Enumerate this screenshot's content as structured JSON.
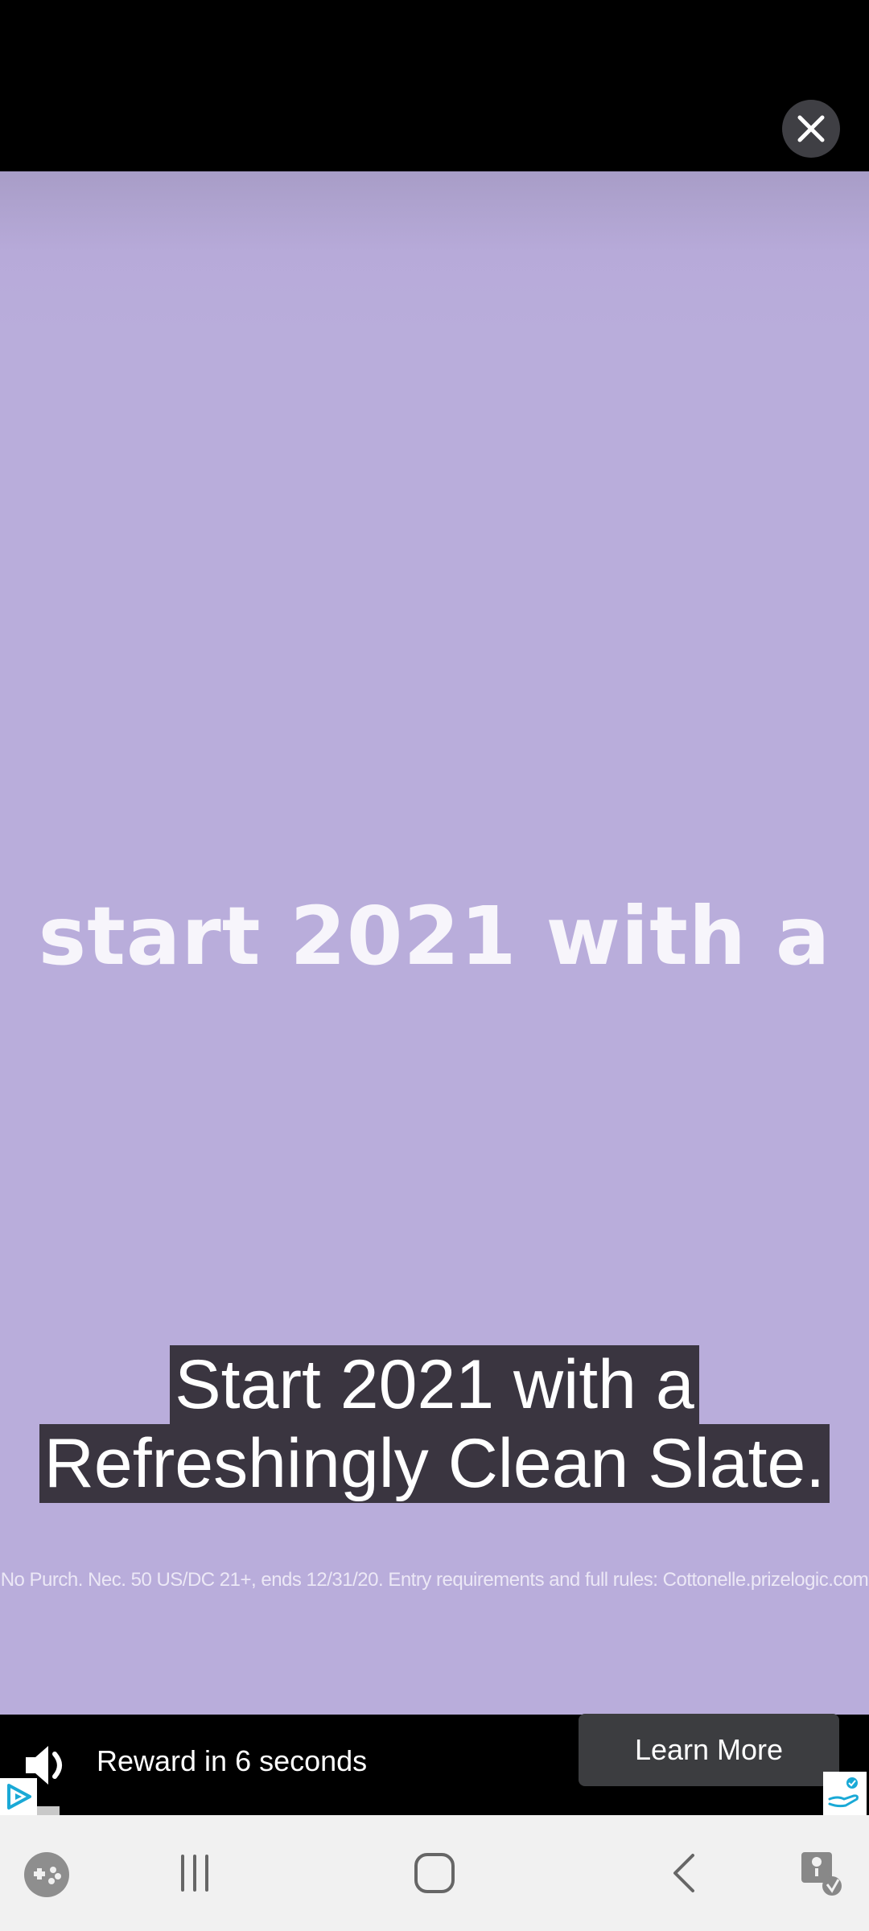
{
  "video": {
    "headline": "start 2021 with a",
    "caption_line1": "Start 2021 with a",
    "caption_line2": "Refreshingly Clean Slate.",
    "fine_print": "No Purch. Nec. 50 US/DC 21+, ends 12/31/20. Entry requirements and full rules: Cottonelle.prizelogic.com"
  },
  "ad_bar": {
    "reward_text": "Reward in 6 seconds",
    "cta_label": "Learn More",
    "sound_icon": "speaker-icon",
    "adchoices_icon": "adchoices-icon",
    "badge_icon": "privacy-hand-icon"
  },
  "top_bar": {
    "close_icon": "close-icon"
  },
  "nav_bar": {
    "items": [
      "game-launcher-icon",
      "recent-apps-icon",
      "home-icon",
      "back-icon",
      "accessibility-icon"
    ]
  },
  "colors": {
    "video_bg": "#b9addb",
    "caption_bg": "#3a3540",
    "button_bg": "#3c3d40",
    "nav_bg": "#f1f1f1"
  }
}
